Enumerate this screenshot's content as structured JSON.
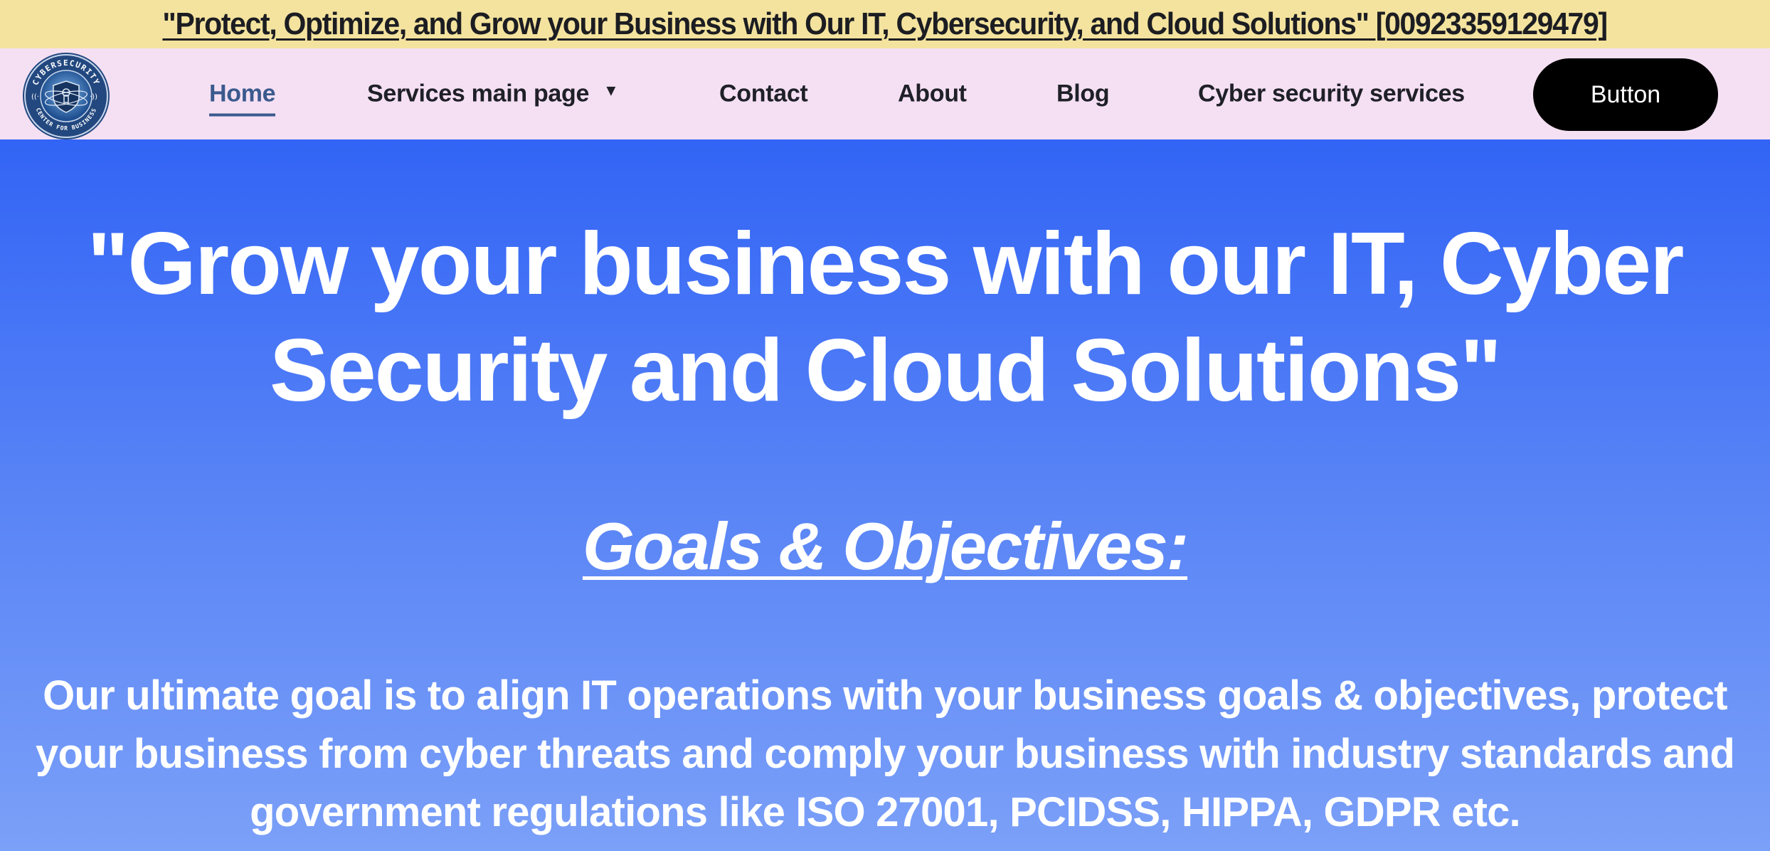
{
  "announcement": {
    "text": "\"Protect, Optimize, and Grow your Business with Our IT, Cybersecurity, and Cloud Solutions\" [00923359129479]"
  },
  "logo": {
    "top_text": "CYBERSECURITY",
    "bottom_text": "CENTER FOR BUSINESS",
    "icon": "shield-globe-icon"
  },
  "nav": {
    "items": [
      {
        "label": "Home",
        "active": true
      },
      {
        "label": "Services main page",
        "has_dropdown": true
      },
      {
        "label": "Contact"
      },
      {
        "label": "About"
      },
      {
        "label": "Blog"
      },
      {
        "label": "Cyber security services"
      }
    ],
    "dropdown_icon": "caret-down-icon",
    "button_label": "Button"
  },
  "hero": {
    "headline": "\"Grow your business with our IT, Cyber Security and Cloud Solutions\"",
    "subheading": "Goals & Objectives:",
    "paragraph": "Our ultimate goal is to align IT operations with your business goals & objectives, protect your business from cyber threats and comply your business with industry standards and government regulations like ISO 27001, PCIDSS, HIPPA, GDPR etc."
  },
  "colors": {
    "announcement_bg": "#f4e39e",
    "navbar_bg": "#f5e0f3",
    "active_nav": "#3b5a8e",
    "hero_gradient_top": "#3264f5",
    "hero_gradient_bottom": "#7ba0f8",
    "button_bg": "#000000"
  }
}
